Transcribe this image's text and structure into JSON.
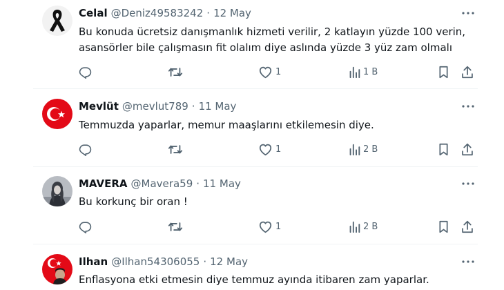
{
  "tweets": [
    {
      "name": "Celal",
      "handle": "@Deniz49583242",
      "separator": "·",
      "date": "12 May",
      "text_lines": [
        "Bu konuda ücretsiz danışmanlık hizmeti verilir, 2 katlayın yüzde 100 verin,",
        "asansörler bile çalışmasın fit olalım diye aslında yüzde 3 yüz zam olmalı"
      ],
      "replies": "",
      "retweets": "",
      "likes": "1",
      "views": "1 B",
      "avatar_icon": "black-ribbon-avatar"
    },
    {
      "name": "Mevlüt",
      "handle": "@mevlut789",
      "separator": "·",
      "date": "11 May",
      "text_lines": [
        "Temmuzda yaparlar, memur maaşlarını etkilemesin diye."
      ],
      "replies": "",
      "retweets": "",
      "likes": "1",
      "views": "2 B",
      "avatar_icon": "turkish-flag-avatar"
    },
    {
      "name": "MAVERA",
      "handle": "@Mavera59",
      "separator": "·",
      "date": "11 May",
      "text_lines": [
        "Bu korkunç bir oran !"
      ],
      "replies": "",
      "retweets": "",
      "likes": "1",
      "views": "2 B",
      "avatar_icon": "portrait-photo-avatar"
    },
    {
      "name": "Ilhan",
      "handle": "@Ilhan54306055",
      "separator": "·",
      "date": "12 May",
      "text_lines": [
        "Enflasyona etki etmesin diye temmuz ayında itibaren zam yaparlar."
      ],
      "avatar_icon": "turkish-flag-portrait-avatar"
    }
  ],
  "colors": {
    "text": "#0f1419",
    "secondary": "#536471",
    "divider": "#eff3f4",
    "flag_red": "#e30a17"
  },
  "icons": [
    "more-icon",
    "reply-icon",
    "retweet-icon",
    "like-icon",
    "views-icon",
    "bookmark-icon",
    "share-icon"
  ]
}
